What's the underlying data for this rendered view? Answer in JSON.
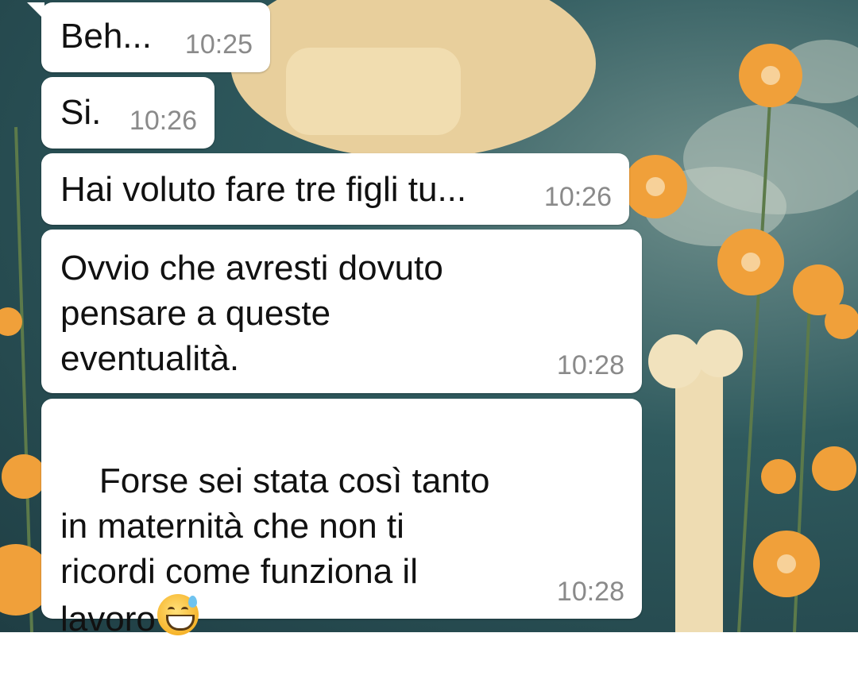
{
  "chat": {
    "messages": [
      {
        "text": "Beh...",
        "time": "10:25"
      },
      {
        "text": "Si.",
        "time": "10:26"
      },
      {
        "text": "Hai voluto fare tre figli tu...",
        "time": "10:26"
      },
      {
        "text": "Ovvio che avresti dovuto\npensare a queste\neventualità.",
        "time": "10:28"
      },
      {
        "text": "Forse sei stata così tanto\nin maternità che non ti\nricordi come funziona il\nlavoro",
        "time": "10:28",
        "emoji": "sweat-smile-emoji"
      }
    ]
  },
  "colors": {
    "bubble": "#ffffff",
    "timestamp": "#8a8a8a",
    "wallpaper": "#2f5a5e"
  }
}
